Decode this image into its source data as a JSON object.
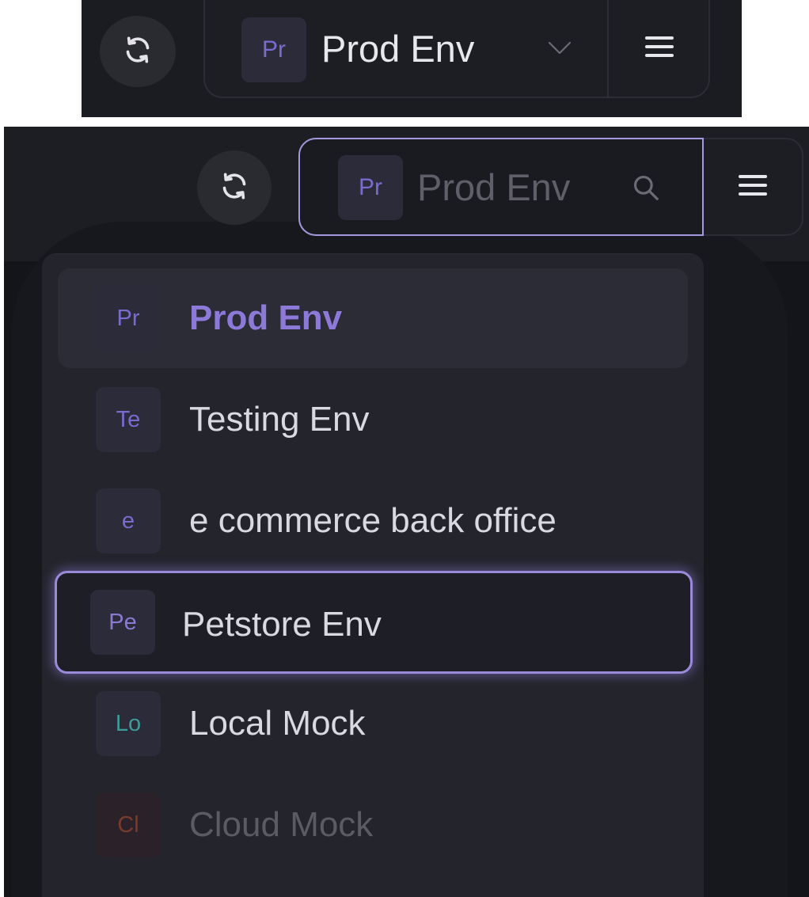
{
  "top_switcher": {
    "refresh_icon": "refresh-icon",
    "selected_env": {
      "badge": "Pr",
      "name": "Prod Env"
    },
    "dropdown_icon": "chevron-down-icon",
    "menu_icon": "hamburger-menu-icon"
  },
  "open_switcher": {
    "refresh_icon": "refresh-icon",
    "search": {
      "badge": "Pr",
      "placeholder": "Prod Env"
    },
    "search_icon": "search-icon",
    "menu_icon": "hamburger-menu-icon",
    "items": [
      {
        "badge": "Pr",
        "label": "Prod Env",
        "badge_color": "#7b6bd1",
        "state": "selected"
      },
      {
        "badge": "Te",
        "label": "Testing Env",
        "badge_color": "#7b6bd1",
        "state": "normal"
      },
      {
        "badge": "e",
        "label": "e commerce back office",
        "badge_color": "#7b6bd1",
        "state": "normal"
      },
      {
        "badge": "Pe",
        "label": "Petstore Env",
        "badge_color": "#8a7ad0",
        "state": "focused"
      },
      {
        "badge": "Lo",
        "label": "Local Mock",
        "badge_color": "#3e9c98",
        "state": "normal"
      },
      {
        "badge": "Cl",
        "label": "Cloud Mock",
        "badge_color": "#7a3a2c",
        "state": "dimmed"
      }
    ]
  },
  "colors": {
    "accent": "#8d7ad8",
    "focus_ring": "#9b8ad9",
    "panel_bg": "#1b1c21",
    "dropdown_bg": "#23242c"
  }
}
